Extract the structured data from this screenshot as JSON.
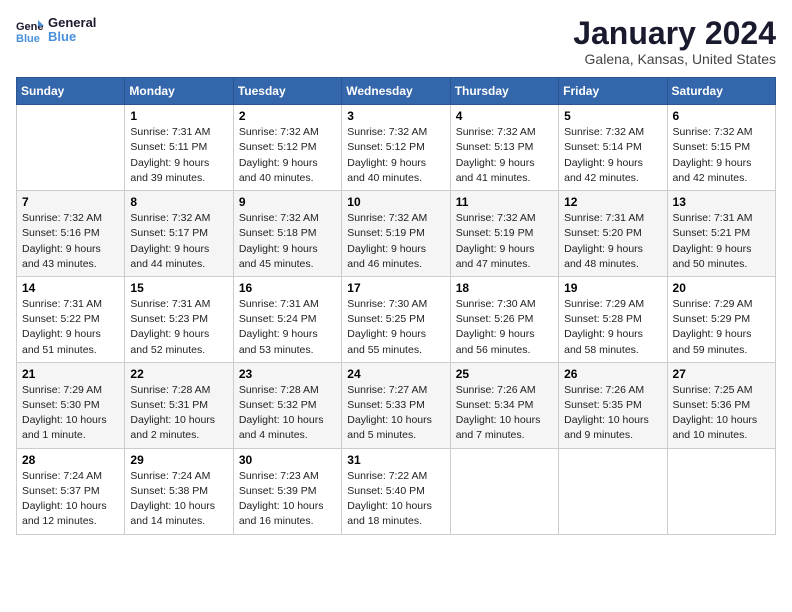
{
  "header": {
    "logo_line1": "General",
    "logo_line2": "Blue",
    "title": "January 2024",
    "subtitle": "Galena, Kansas, United States"
  },
  "days_of_week": [
    "Sunday",
    "Monday",
    "Tuesday",
    "Wednesday",
    "Thursday",
    "Friday",
    "Saturday"
  ],
  "weeks": [
    [
      {
        "day": "",
        "info": ""
      },
      {
        "day": "1",
        "info": "Sunrise: 7:31 AM\nSunset: 5:11 PM\nDaylight: 9 hours\nand 39 minutes."
      },
      {
        "day": "2",
        "info": "Sunrise: 7:32 AM\nSunset: 5:12 PM\nDaylight: 9 hours\nand 40 minutes."
      },
      {
        "day": "3",
        "info": "Sunrise: 7:32 AM\nSunset: 5:12 PM\nDaylight: 9 hours\nand 40 minutes."
      },
      {
        "day": "4",
        "info": "Sunrise: 7:32 AM\nSunset: 5:13 PM\nDaylight: 9 hours\nand 41 minutes."
      },
      {
        "day": "5",
        "info": "Sunrise: 7:32 AM\nSunset: 5:14 PM\nDaylight: 9 hours\nand 42 minutes."
      },
      {
        "day": "6",
        "info": "Sunrise: 7:32 AM\nSunset: 5:15 PM\nDaylight: 9 hours\nand 42 minutes."
      }
    ],
    [
      {
        "day": "7",
        "info": "Sunrise: 7:32 AM\nSunset: 5:16 PM\nDaylight: 9 hours\nand 43 minutes."
      },
      {
        "day": "8",
        "info": "Sunrise: 7:32 AM\nSunset: 5:17 PM\nDaylight: 9 hours\nand 44 minutes."
      },
      {
        "day": "9",
        "info": "Sunrise: 7:32 AM\nSunset: 5:18 PM\nDaylight: 9 hours\nand 45 minutes."
      },
      {
        "day": "10",
        "info": "Sunrise: 7:32 AM\nSunset: 5:19 PM\nDaylight: 9 hours\nand 46 minutes."
      },
      {
        "day": "11",
        "info": "Sunrise: 7:32 AM\nSunset: 5:19 PM\nDaylight: 9 hours\nand 47 minutes."
      },
      {
        "day": "12",
        "info": "Sunrise: 7:31 AM\nSunset: 5:20 PM\nDaylight: 9 hours\nand 48 minutes."
      },
      {
        "day": "13",
        "info": "Sunrise: 7:31 AM\nSunset: 5:21 PM\nDaylight: 9 hours\nand 50 minutes."
      }
    ],
    [
      {
        "day": "14",
        "info": "Sunrise: 7:31 AM\nSunset: 5:22 PM\nDaylight: 9 hours\nand 51 minutes."
      },
      {
        "day": "15",
        "info": "Sunrise: 7:31 AM\nSunset: 5:23 PM\nDaylight: 9 hours\nand 52 minutes."
      },
      {
        "day": "16",
        "info": "Sunrise: 7:31 AM\nSunset: 5:24 PM\nDaylight: 9 hours\nand 53 minutes."
      },
      {
        "day": "17",
        "info": "Sunrise: 7:30 AM\nSunset: 5:25 PM\nDaylight: 9 hours\nand 55 minutes."
      },
      {
        "day": "18",
        "info": "Sunrise: 7:30 AM\nSunset: 5:26 PM\nDaylight: 9 hours\nand 56 minutes."
      },
      {
        "day": "19",
        "info": "Sunrise: 7:29 AM\nSunset: 5:28 PM\nDaylight: 9 hours\nand 58 minutes."
      },
      {
        "day": "20",
        "info": "Sunrise: 7:29 AM\nSunset: 5:29 PM\nDaylight: 9 hours\nand 59 minutes."
      }
    ],
    [
      {
        "day": "21",
        "info": "Sunrise: 7:29 AM\nSunset: 5:30 PM\nDaylight: 10 hours\nand 1 minute."
      },
      {
        "day": "22",
        "info": "Sunrise: 7:28 AM\nSunset: 5:31 PM\nDaylight: 10 hours\nand 2 minutes."
      },
      {
        "day": "23",
        "info": "Sunrise: 7:28 AM\nSunset: 5:32 PM\nDaylight: 10 hours\nand 4 minutes."
      },
      {
        "day": "24",
        "info": "Sunrise: 7:27 AM\nSunset: 5:33 PM\nDaylight: 10 hours\nand 5 minutes."
      },
      {
        "day": "25",
        "info": "Sunrise: 7:26 AM\nSunset: 5:34 PM\nDaylight: 10 hours\nand 7 minutes."
      },
      {
        "day": "26",
        "info": "Sunrise: 7:26 AM\nSunset: 5:35 PM\nDaylight: 10 hours\nand 9 minutes."
      },
      {
        "day": "27",
        "info": "Sunrise: 7:25 AM\nSunset: 5:36 PM\nDaylight: 10 hours\nand 10 minutes."
      }
    ],
    [
      {
        "day": "28",
        "info": "Sunrise: 7:24 AM\nSunset: 5:37 PM\nDaylight: 10 hours\nand 12 minutes."
      },
      {
        "day": "29",
        "info": "Sunrise: 7:24 AM\nSunset: 5:38 PM\nDaylight: 10 hours\nand 14 minutes."
      },
      {
        "day": "30",
        "info": "Sunrise: 7:23 AM\nSunset: 5:39 PM\nDaylight: 10 hours\nand 16 minutes."
      },
      {
        "day": "31",
        "info": "Sunrise: 7:22 AM\nSunset: 5:40 PM\nDaylight: 10 hours\nand 18 minutes."
      },
      {
        "day": "",
        "info": ""
      },
      {
        "day": "",
        "info": ""
      },
      {
        "day": "",
        "info": ""
      }
    ]
  ]
}
